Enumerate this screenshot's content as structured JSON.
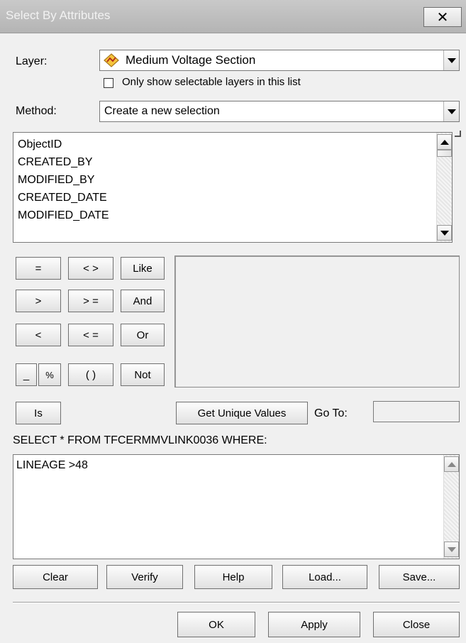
{
  "window": {
    "title": "Select By Attributes",
    "close_glyph": "✕"
  },
  "layer": {
    "label": "Layer:",
    "value": "Medium Voltage Section",
    "icon": "polyline-layer-icon",
    "only_selectable_label": "Only show selectable layers in this list",
    "only_selectable_checked": false
  },
  "method": {
    "label": "Method:",
    "value": "Create a new selection"
  },
  "fields": [
    "ObjectID",
    "CREATED_BY",
    "MODIFIED_BY",
    "CREATED_DATE",
    "MODIFIED_DATE"
  ],
  "operators": {
    "equals": "=",
    "not_equals": "< >",
    "like": "Like",
    "greater": ">",
    "greater_equal": "> =",
    "and": "And",
    "less": "<",
    "less_equal": "< =",
    "or": "Or",
    "underscore": "_",
    "percent": "%",
    "parens": "( )",
    "not": "Not",
    "is": "Is"
  },
  "get_unique_values": "Get Unique Values",
  "goto": {
    "label": "Go To:",
    "value": ""
  },
  "query": {
    "prefix": "SELECT * FROM TFCERMMVLINK0036 WHERE:",
    "expression": "LINEAGE >48"
  },
  "query_buttons": {
    "clear": "Clear",
    "verify": "Verify",
    "help": "Help",
    "load": "Load...",
    "save": "Save..."
  },
  "dialog_buttons": {
    "ok": "OK",
    "apply": "Apply",
    "close": "Close"
  }
}
